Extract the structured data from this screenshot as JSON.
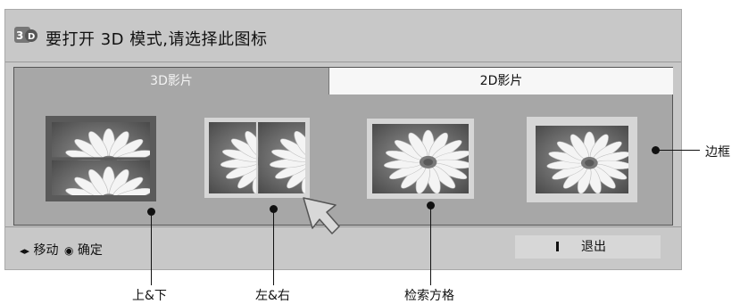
{
  "header": {
    "icon": "3d-logo-icon",
    "title": "要打开 3D 模式,请选择此图标"
  },
  "tabs": [
    {
      "label": "3D影片",
      "selected": true
    },
    {
      "label": "2D影片",
      "selected": false
    }
  ],
  "modes": [
    {
      "id": "top-bottom",
      "label": "上&下",
      "selected": true
    },
    {
      "id": "left-right",
      "label": "左&右",
      "selected": false
    },
    {
      "id": "checkerboard",
      "label": "检索方格",
      "selected": false
    },
    {
      "id": "frame",
      "label": "",
      "selected": false
    }
  ],
  "footer": {
    "move_glyph": "◂▸",
    "move_label": "移动",
    "ok_glyph": "◉",
    "ok_label": "确定",
    "exit_label": "退出"
  },
  "callouts": {
    "top_bottom": "上&下",
    "left_right": "左&右",
    "checkerboard": "检索方格",
    "frame": "边框"
  },
  "colors": {
    "panel_bg": "#c8c8c8",
    "content_bg": "#a7a7a7",
    "selected_frame": "#555555",
    "thumb_frame": "#d6d6d6"
  }
}
